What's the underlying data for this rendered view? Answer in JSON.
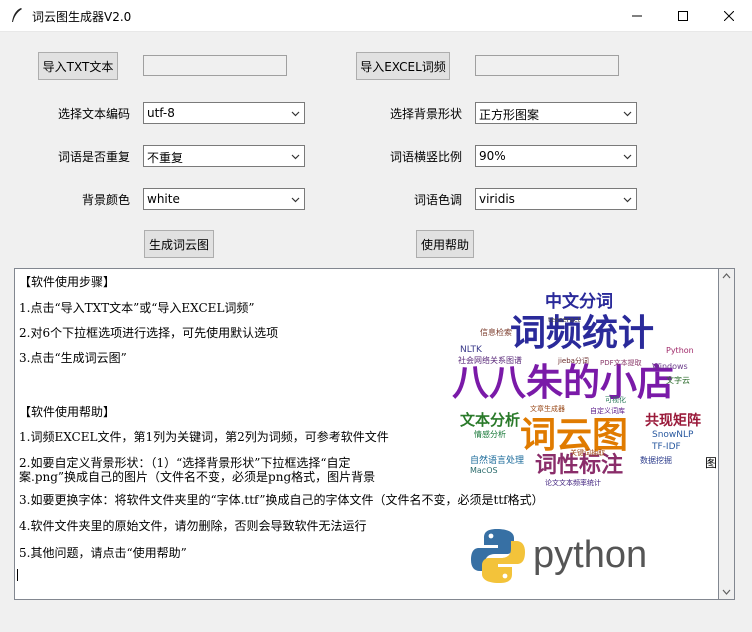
{
  "window": {
    "title": "词云图生成器V2.0",
    "title_icon": "feather-icon",
    "controls": [
      "minimize-icon",
      "maximize-icon",
      "close-icon"
    ]
  },
  "toolbar": {
    "import_txt_label": "导入TXT文本",
    "import_excel_label": "导入EXCEL词频",
    "import_txt_path": "",
    "import_excel_path": ""
  },
  "options": {
    "encoding_label": "选择文本编码",
    "encoding_value": "utf-8",
    "repeat_label": "词语是否重复",
    "repeat_value": "不重复",
    "bg_color_label": "背景颜色",
    "bg_color_value": "white",
    "bg_shape_label": "选择背景形状",
    "bg_shape_value": "正方形图案",
    "ratio_label": "词语横竖比例",
    "ratio_value": "90%",
    "colormap_label": "词语色调",
    "colormap_value": "viridis"
  },
  "actions": {
    "generate_label": "生成词云图",
    "help_label": "使用帮助"
  },
  "help_text": {
    "lines": [
      "【软件使用步骤】",
      "1.点击“导入TXT文本”或“导入EXCEL词频”",
      "2.对6个下拉框选项进行选择，可先使用默认选项",
      "3.点击“生成词云图”",
      "",
      "【软件使用帮助】",
      "1.词频EXCEL文件，第1列为关键词，第2列为词频，可参考软件文件",
      "2.如要自定义背景形状：（1）“选择背景形状”下拉框选择“自定",
      "案.png”换成自己的图片（文件名不变，必须是png格式，图片背景",
      "3.如要更换字体：将软件文件夹里的“字体.ttf”换成自己的字体文件（文件名不变，必须是ttf格式）",
      "4.软件文件夹里的原始文件，请勿删除，否则会导致软件无法运行",
      "5.其他问题，请点击“使用帮助”"
    ],
    "overflow_char": "图"
  },
  "wordcloud": {
    "words": [
      {
        "text": "八八朱的小店",
        "color": "#7a1aa8"
      },
      {
        "text": "词频统计",
        "color": "#2a2a9a"
      },
      {
        "text": "词云图",
        "color": "#e07b00"
      },
      {
        "text": "词性标注",
        "color": "#8a2d6a"
      },
      {
        "text": "中文分词",
        "color": "#2a2a9a"
      },
      {
        "text": "文本分析",
        "color": "#2a7a2a"
      },
      {
        "text": "共现矩阵",
        "color": "#9a1a3a"
      },
      {
        "text": "自然语言处理",
        "color": "#1a6a9a"
      },
      {
        "text": "社会网络关系图谱",
        "color": "#5a2a7a"
      },
      {
        "text": "SnowNLP",
        "color": "#2a5aa0"
      },
      {
        "text": "TF-IDF",
        "color": "#2a5aa0"
      },
      {
        "text": "Python",
        "color": "#a02a6a"
      },
      {
        "text": "NLTK",
        "color": "#3a3a8a"
      },
      {
        "text": "jieba分词",
        "color": "#6a2a2a"
      },
      {
        "text": "MacOS",
        "color": "#2a6a6a"
      },
      {
        "text": "Windows",
        "color": "#6a3a8a"
      },
      {
        "text": "数据挖掘",
        "color": "#2a3a8a"
      },
      {
        "text": "可视化",
        "color": "#2a7a5a"
      },
      {
        "text": "tesseract",
        "color": "#4a4a4a"
      },
      {
        "text": "信息检索",
        "color": "#7a3a2a"
      },
      {
        "text": "文字云",
        "color": "#2a6a2a"
      },
      {
        "text": "PDF文本提取",
        "color": "#8a3a6a"
      },
      {
        "text": "自定义词库",
        "color": "#5a1a8a"
      },
      {
        "text": "文章生成器",
        "color": "#9a4a1a"
      },
      {
        "text": "情感分析",
        "color": "#1a7a3a"
      },
      {
        "text": "关键词抽取",
        "color": "#a04a1a"
      },
      {
        "text": "论文文本频率统计",
        "color": "#3a1a7a"
      }
    ],
    "logo_text": "python",
    "logo_blue": "#3770a4",
    "logo_yellow": "#f3c33a"
  }
}
